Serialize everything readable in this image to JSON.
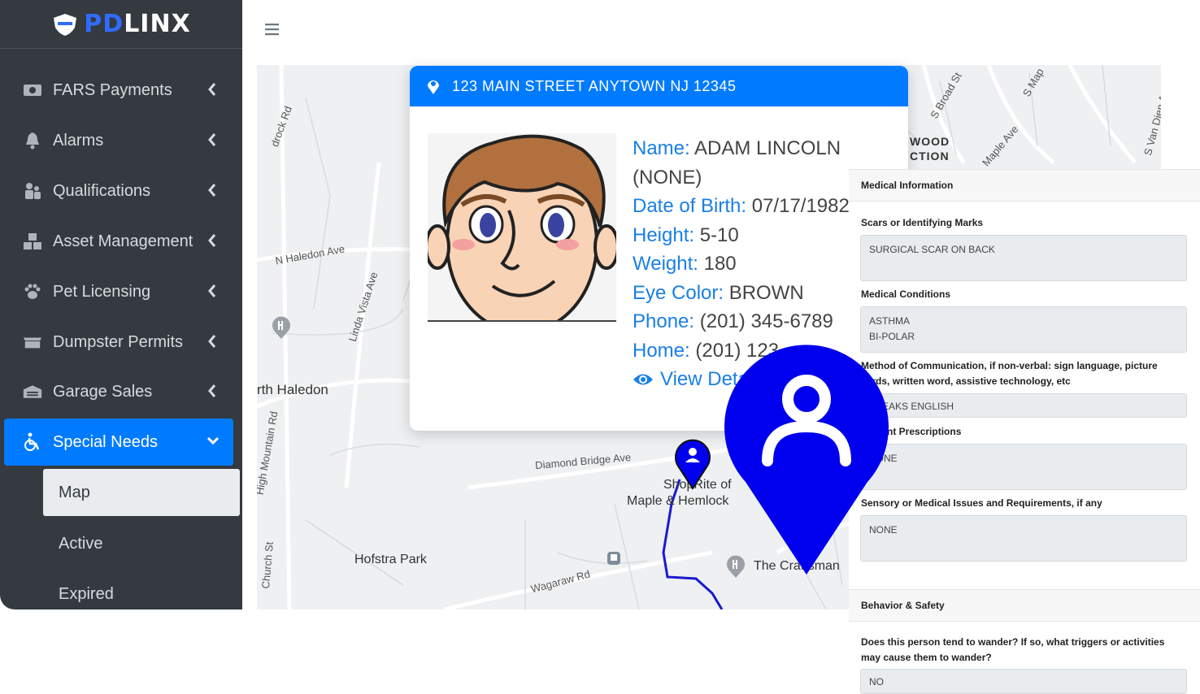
{
  "brand": {
    "pd": "PD",
    "linx": "LINX"
  },
  "sidebar": {
    "items": [
      {
        "label": "FARS Payments",
        "icon": "money-icon"
      },
      {
        "label": "Alarms",
        "icon": "bell-icon"
      },
      {
        "label": "Qualifications",
        "icon": "users-icon"
      },
      {
        "label": "Asset Management",
        "icon": "boxes-icon"
      },
      {
        "label": "Pet Licensing",
        "icon": "paw-icon"
      },
      {
        "label": "Dumpster Permits",
        "icon": "dumpster-icon"
      },
      {
        "label": "Garage Sales",
        "icon": "warehouse-icon"
      },
      {
        "label": "Special Needs",
        "icon": "wheelchair-icon"
      }
    ],
    "subitems": [
      {
        "label": "Map"
      },
      {
        "label": "Active"
      },
      {
        "label": "Expired"
      }
    ]
  },
  "map": {
    "labels": [
      "N Haledon Ave",
      "Linda Vista Ave",
      "High Mountain Rd",
      "Church St",
      "Diamond Bridge Ave",
      "Wagaraw Rd",
      "S Broad St",
      "Maple Ave",
      "S Van Dien Ave",
      "S Map",
      "drock Rd"
    ],
    "places": [
      "rth Haledon",
      "Hofstra Park",
      "ShopRite of",
      "Maple & Hemlock",
      "The Craftsman",
      "WOOD",
      "CTION"
    ]
  },
  "card": {
    "address": "123 MAIN STREET ANYTOWN NJ 12345",
    "name_label": "Name:",
    "name": "ADAM LINCOLN",
    "alias": "(NONE)",
    "dob_label": "Date of Birth:",
    "dob": "07/17/1982",
    "height_label": "Height:",
    "height": "5-10",
    "weight_label": "Weight:",
    "weight": "180",
    "eye_label": "Eye Color:",
    "eye": "BROWN",
    "phone_label": "Phone:",
    "phone": "(201) 345-6789",
    "home_label": "Home:",
    "home": "(201) 123",
    "view_details": "View Deta"
  },
  "medical": {
    "header": "Medical Information",
    "scars_label": "Scars or Identifying Marks",
    "scars_value": "SURGICAL SCAR ON BACK",
    "conditions_label": "Medical Conditions",
    "conditions_value_1": "ASTHMA",
    "conditions_value_2": "BI-POLAR",
    "communication_label": "Method of Communication, if non-verbal: sign language, picture cards, written word, assistive technology, etc",
    "communication_value": "SPEAKS ENGLISH",
    "prescriptions_label": "Current Prescriptions",
    "prescriptions_value": "NONE",
    "sensory_label": "Sensory or Medical Issues and Requirements, if any",
    "sensory_value": "NONE"
  },
  "behavior": {
    "header": "Behavior & Safety",
    "wander_label": "Does this person tend to wander? If so, what triggers or activities may cause them to wander?",
    "wander_value": "NO"
  },
  "colors": {
    "primary": "#007bff",
    "sidebar": "#343a40",
    "pin": "#0000ee"
  }
}
